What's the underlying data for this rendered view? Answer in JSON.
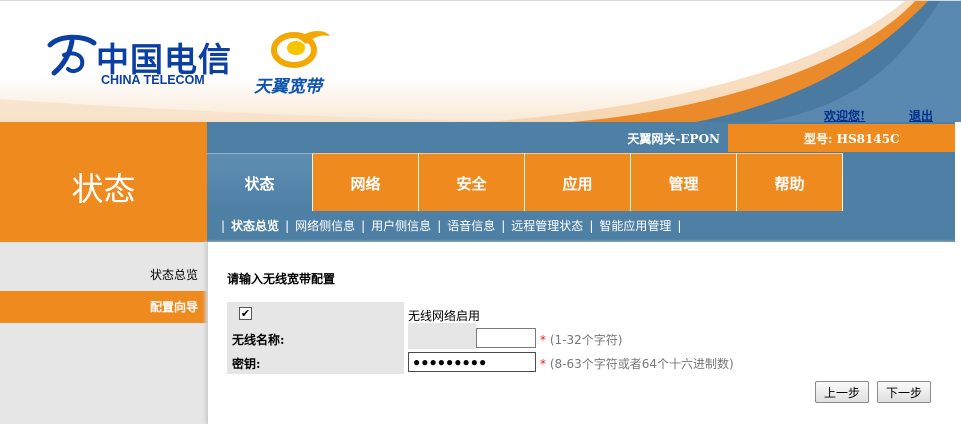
{
  "header": {
    "brand_cn": "中国电信",
    "brand_en": "CHINA TELECOM",
    "product_name": "天翼宽带",
    "welcome_label": "欢迎您!",
    "logout_label": "退出"
  },
  "gateway": {
    "name": "天翼网关-EPON",
    "model": "型号: HS8145C"
  },
  "section_title": "状态",
  "tabs": [
    {
      "label": "状态",
      "active": true
    },
    {
      "label": "网络",
      "active": false
    },
    {
      "label": "安全",
      "active": false
    },
    {
      "label": "应用",
      "active": false
    },
    {
      "label": "管理",
      "active": false
    },
    {
      "label": "帮助",
      "active": false
    }
  ],
  "subnav": [
    {
      "label": "状态总览",
      "active": true
    },
    {
      "label": "网络侧信息",
      "active": false
    },
    {
      "label": "用户侧信息",
      "active": false
    },
    {
      "label": "语音信息",
      "active": false
    },
    {
      "label": "远程管理状态",
      "active": false
    },
    {
      "label": "智能应用管理",
      "active": false
    }
  ],
  "subnav_separator": "|",
  "sidebar": {
    "items": [
      {
        "label": "状态总览",
        "active": false
      },
      {
        "label": "配置向导",
        "active": true
      }
    ]
  },
  "form": {
    "title": "请输入无线宽带配置",
    "enable_checked": true,
    "enable_label": "无线网络启用",
    "ssid_label": "无线名称:",
    "ssid_value": "",
    "ssid_hint": "(1-32个字符)",
    "key_label": "密钥:",
    "key_value": "●●●●●●●●●",
    "key_hint": "(8-63个字符或者64个十六进制数)",
    "required_mark": "*",
    "prev_label": "上一步",
    "next_label": "下一步"
  },
  "colors": {
    "accent_orange": "#ef8a1f",
    "nav_blue": "#4e7fa4",
    "brand_blue": "#0b3fa4",
    "sidebar_grey": "#e6e6e6"
  }
}
